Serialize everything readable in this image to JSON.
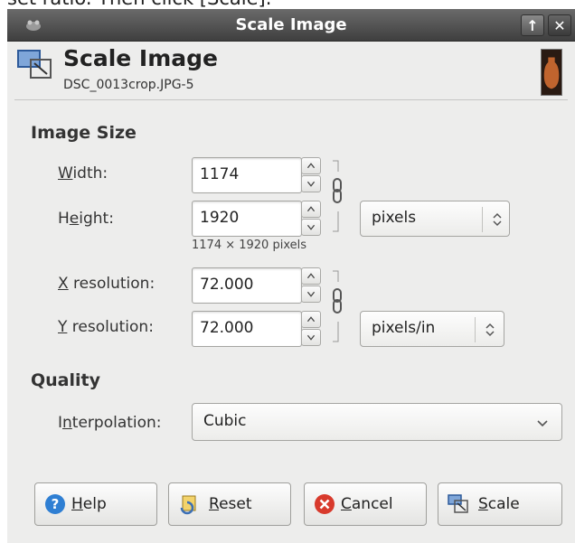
{
  "caption": "set ratio. Then click [Scale].",
  "window": {
    "title": "Scale Image"
  },
  "header": {
    "title": "Scale Image",
    "subtitle": "DSC_0013crop.JPG-5"
  },
  "image_size": {
    "section_title": "Image Size",
    "width": {
      "label_prefix": "",
      "label_mnemonic": "W",
      "label_rest": "idth:",
      "value": "1174"
    },
    "height": {
      "label_prefix": "H",
      "label_mnemonic": "e",
      "label_rest": "ight:",
      "value": "1920"
    },
    "size_unit": "pixels",
    "size_hint": "1174 × 1920 pixels",
    "x_res": {
      "label_mnemonic": "X",
      "label_rest": " resolution:",
      "value": "72.000"
    },
    "y_res": {
      "label_mnemonic": "Y",
      "label_rest": " resolution:",
      "value": "72.000"
    },
    "res_unit": "pixels/in"
  },
  "quality": {
    "section_title": "Quality",
    "interp_prefix": "I",
    "interp_mnemonic": "n",
    "interp_rest": "terpolation:",
    "interpolation": "Cubic"
  },
  "buttons": {
    "help": {
      "mnemonic": "H",
      "rest": "elp"
    },
    "reset": {
      "mnemonic": "R",
      "rest": "eset"
    },
    "cancel": {
      "mnemonic": "C",
      "rest": "ancel"
    },
    "scale": {
      "mnemonic": "S",
      "rest": "cale"
    }
  },
  "colors": {
    "titlebar": "#4f4f4f",
    "dialog_bg": "#ededec",
    "help_icon": "#2f7fd3",
    "cancel_icon": "#d83a2c"
  },
  "icons": [
    "gimp-wilber-icon",
    "scale-image-icon",
    "chain-link-icon",
    "chevron-updown-icon",
    "chevron-down-icon",
    "help-icon",
    "reset-icon",
    "cancel-icon",
    "scale-icon"
  ]
}
